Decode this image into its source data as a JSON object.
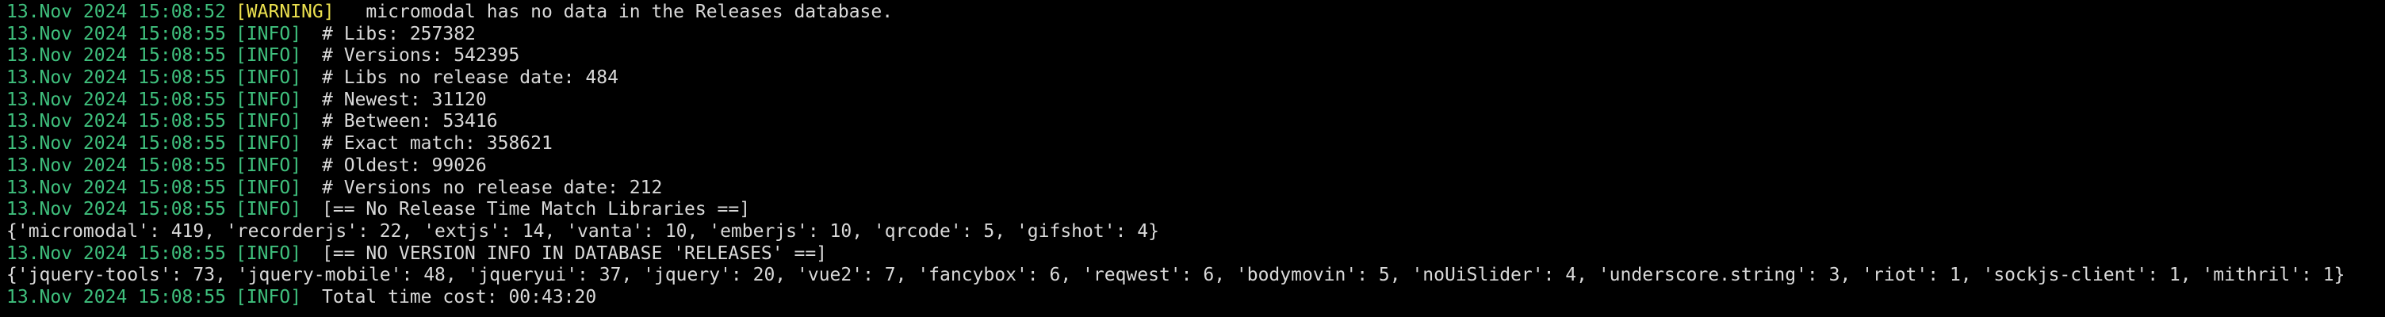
{
  "colors": {
    "background": "#000000",
    "timestamp": "#3fc07d",
    "info": "#3fc07d",
    "warning": "#ece14f",
    "text": "#d9d9d9"
  },
  "lines": [
    {
      "ts": "13.Nov 2024 15:08:52",
      "level": "[WARNING]",
      "msg": " micromodal has no data in the Releases database."
    },
    {
      "ts": "13.Nov 2024 15:08:55",
      "level": "[INFO]",
      "msg": "# Libs: 257382"
    },
    {
      "ts": "13.Nov 2024 15:08:55",
      "level": "[INFO]",
      "msg": "# Versions: 542395"
    },
    {
      "ts": "13.Nov 2024 15:08:55",
      "level": "[INFO]",
      "msg": "# Libs no release date: 484"
    },
    {
      "ts": "13.Nov 2024 15:08:55",
      "level": "[INFO]",
      "msg": "# Newest: 31120"
    },
    {
      "ts": "13.Nov 2024 15:08:55",
      "level": "[INFO]",
      "msg": "# Between: 53416"
    },
    {
      "ts": "13.Nov 2024 15:08:55",
      "level": "[INFO]",
      "msg": "# Exact match: 358621"
    },
    {
      "ts": "13.Nov 2024 15:08:55",
      "level": "[INFO]",
      "msg": "# Oldest: 99026"
    },
    {
      "ts": "13.Nov 2024 15:08:55",
      "level": "[INFO]",
      "msg": "# Versions no release date: 212"
    },
    {
      "ts": "13.Nov 2024 15:08:55",
      "level": "[INFO]",
      "msg": "[== No Release Time Match Libraries ==]"
    },
    {
      "raw": "{'micromodal': 419, 'recorderjs': 22, 'extjs': 14, 'vanta': 10, 'emberjs': 10, 'qrcode': 5, 'gifshot': 4}"
    },
    {
      "ts": "13.Nov 2024 15:08:55",
      "level": "[INFO]",
      "msg": "[== NO VERSION INFO IN DATABASE 'RELEASES' ==]"
    },
    {
      "raw": "{'jquery-tools': 73, 'jquery-mobile': 48, 'jqueryui': 37, 'jquery': 20, 'vue2': 7, 'fancybox': 6, 'reqwest': 6, 'bodymovin': 5, 'noUiSlider': 4, 'underscore.string': 3, 'riot': 1, 'sockjs-client': 1, 'mithril': 1}"
    },
    {
      "ts": "13.Nov 2024 15:08:55",
      "level": "[INFO]",
      "msg": "Total time cost: 00:43:20"
    }
  ]
}
